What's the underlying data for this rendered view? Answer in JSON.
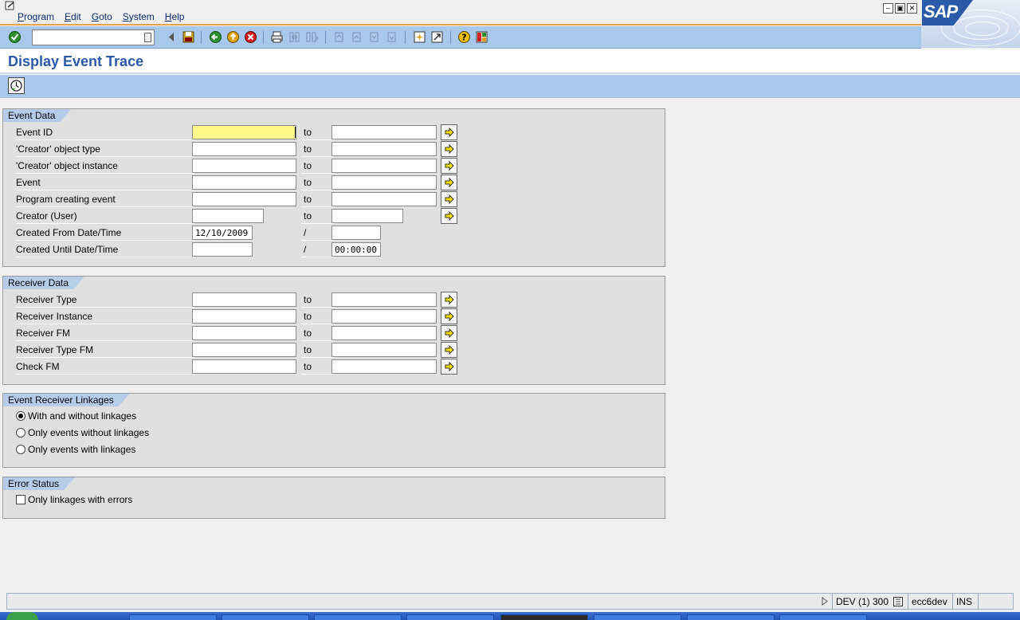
{
  "menu": {
    "items": [
      {
        "label": "Program"
      },
      {
        "label": "Edit"
      },
      {
        "label": "Goto"
      },
      {
        "label": "System"
      },
      {
        "label": "Help"
      }
    ]
  },
  "branding": {
    "logo_text": "SAP"
  },
  "toolbar": {
    "command_field": {
      "value": ""
    }
  },
  "title": "Display Event Trace",
  "event_data": {
    "title": "Event Data",
    "to_label": "to",
    "slash": "/",
    "rows": [
      {
        "label": "Event ID",
        "to": "to",
        "from_value": "",
        "to_value": ""
      },
      {
        "label": "'Creator' object type",
        "to": "to",
        "from_value": "",
        "to_value": ""
      },
      {
        "label": "'Creator' object instance",
        "to": "to",
        "from_value": "",
        "to_value": ""
      },
      {
        "label": "Event",
        "to": "to",
        "from_value": "",
        "to_value": ""
      },
      {
        "label": "Program creating event",
        "to": "to",
        "from_value": "",
        "to_value": ""
      },
      {
        "label": "Creator (User)",
        "to": "to",
        "from_value": "",
        "to_value": ""
      },
      {
        "label": "Created From Date/Time",
        "to": "/",
        "from_value": "12/10/2009",
        "to_value": ""
      },
      {
        "label": "Created Until Date/Time",
        "to": "/",
        "from_value": "",
        "to_value": "00:00:00"
      }
    ]
  },
  "receiver_data": {
    "title": "Receiver Data",
    "rows": [
      {
        "label": "Receiver Type",
        "to": "to"
      },
      {
        "label": "Receiver Instance",
        "to": "to"
      },
      {
        "label": "Receiver FM",
        "to": "to"
      },
      {
        "label": "Receiver Type FM",
        "to": "to"
      },
      {
        "label": "Check FM",
        "to": "to"
      }
    ]
  },
  "linkages": {
    "title": "Event Receiver Linkages",
    "options": [
      {
        "label": "With and without linkages",
        "selected": true
      },
      {
        "label": "Only events without linkages",
        "selected": false
      },
      {
        "label": "Only events with linkages",
        "selected": false
      }
    ]
  },
  "error_status": {
    "title": "Error Status",
    "checkbox_label": "Only linkages with errors",
    "checked": false
  },
  "status_bar": {
    "system": "DEV (1) 300",
    "server": "ecc6dev",
    "mode": "INS"
  },
  "colors": {
    "accent": "#2a5aa8",
    "toolbar": "#a8c8ec",
    "focus_field": "#fff989"
  }
}
